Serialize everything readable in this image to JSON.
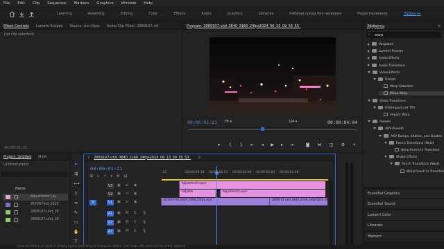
{
  "menu": [
    "File",
    "Edit",
    "Clip",
    "Sequence",
    "Markers",
    "Graphics",
    "Window",
    "Help"
  ],
  "workspaces": {
    "tabs": [
      "Learning",
      "Assembly",
      "Editing",
      "Color",
      "Effects",
      "Audio",
      "Graphics",
      "Libraries",
      "Рабочая среда без названия",
      "Редактирование",
      "Эффекты"
    ],
    "active": "Эффекты"
  },
  "source_panel": {
    "tabs": [
      "Effect Controls",
      "Lumetri Scopes",
      "Source: (no clips)",
      "Audio Clip Mixer: 2869107-ult"
    ],
    "no_clip": "(no clip selected)",
    "timecode": "00:00:01:21"
  },
  "program": {
    "title": "Program: 2869107-uhd_3840_2160_24fps2024_06_13_09_50_53_",
    "timecode": "00:00:01:21",
    "fit": "Fit",
    "fraction": "1/4",
    "duration": "00:00:04:04"
  },
  "effects": {
    "title": "Эффекты",
    "search_value": "warp",
    "tree": [
      {
        "label": "Vorgaben",
        "level": 0,
        "kind": "folder",
        "open": false
      },
      {
        "label": "Lumetri Presets",
        "level": 0,
        "kind": "folder",
        "open": false
      },
      {
        "label": "Audio Effects",
        "level": 0,
        "kind": "folder",
        "open": false
      },
      {
        "label": "Audio Transitions",
        "level": 0,
        "kind": "folder",
        "open": false
      },
      {
        "label": "Video Effects",
        "level": 0,
        "kind": "folder",
        "open": true
      },
      {
        "label": "Distort",
        "level": 1,
        "kind": "folder",
        "open": true
      },
      {
        "label": "Warp Stabilizer",
        "level": 2,
        "kind": "effect"
      },
      {
        "label": "Wave Warp",
        "level": 2,
        "kind": "effect",
        "selected": true
      },
      {
        "label": "Video Transitions",
        "level": 0,
        "kind": "folder",
        "open": true
      },
      {
        "label": "FilmImpact.net TP4",
        "level": 1,
        "kind": "folder",
        "open": true
      },
      {
        "label": "Impact Warp",
        "level": 2,
        "kind": "effect"
      },
      {
        "label": "Presets",
        "level": 0,
        "kind": "folder",
        "open": true
      },
      {
        "label": "AKV Presets",
        "level": 1,
        "kind": "folder",
        "open": true
      },
      {
        "label": "AKV Bumps, Shakes, and Quakes",
        "level": 2,
        "kind": "folder",
        "open": true
      },
      {
        "label": "Punch Transitions (Nest)",
        "level": 3,
        "kind": "folder",
        "open": true
      },
      {
        "label": "Warp Punch In Transition",
        "level": 4,
        "kind": "effect"
      },
      {
        "label": "Shake Effects",
        "level": 3,
        "kind": "folder",
        "open": true
      },
      {
        "label": "Punch Transitions (Nest)",
        "level": 4,
        "kind": "folder",
        "open": true
      },
      {
        "label": "Warp Punch In Transition",
        "level": 5,
        "kind": "effect"
      }
    ],
    "bottom_panels": [
      "Essential Graphics",
      "Essential Sound",
      "Lumetri Color",
      "Libraries",
      "Markers"
    ]
  },
  "project": {
    "tabs": [
      "Project: Untitled",
      "Medi"
    ],
    "file": "Untitled.prproj",
    "column": "Name",
    "items": [
      {
        "name": "Adjustment Lay",
        "color": "#e8a0e0"
      },
      {
        "name": "857267-hd_1920",
        "color": "#7b6fd6"
      },
      {
        "name": "2869107-uhd_38",
        "color": "#8ed06a"
      },
      {
        "name": "2869107-uhd_38",
        "color": "#8ed06a"
      }
    ]
  },
  "timeline": {
    "tab": "2869107-uhd_3840_2160_24fps2024_06_13_09_50_53_",
    "timecode": "00:00:01:21",
    "ruler": [
      ":15",
      "00:00:00:18",
      "00:00:01:21",
      "00:00:02:00",
      "00:00:02:03",
      "00:00:02:06"
    ],
    "video_tracks": [
      {
        "name": "V3",
        "label": "V3"
      },
      {
        "name": "V2",
        "label": "V2"
      },
      {
        "name": "V1",
        "label": "V1",
        "target": "V"
      }
    ],
    "audio_tracks": [
      "A1",
      "A2",
      "A3"
    ],
    "clips": {
      "v3_a": "Adjustment Layer",
      "v2_a": "Adjustm",
      "v2_b": "Adjustment Layer",
      "v1_a": "857267-hd_1920_1080_25fps.mp4",
      "v1_b": "2869107-uhd_3840_2160_24fps2024_06_13_09_5"
    },
    "colors": {
      "adjustment": "#e593e0",
      "video": "#9d7fd9"
    }
  },
  "status": "Click to select, or click in empty space and drag to marquee select. Use Shift, Alt, and Ctrl for other options."
}
